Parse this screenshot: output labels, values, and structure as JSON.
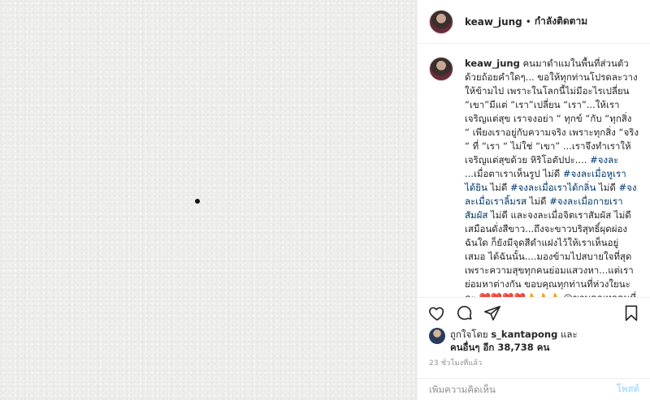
{
  "post": {
    "username": "keaw_jung",
    "separator": "•",
    "follow_status": "กำลังติดตาม"
  },
  "caption": {
    "username": "keaw_jung",
    "text_1": " คนมาดำแมในพื้นที่ส่วนตัว ด้วยถ้อยคำใดๆ... ขอให้ทุกท่านโปรดละวางให้ข้ามไป เพราะในโลกนี้ไม่มีอะไรเปลี่ยน “เขา”มีแต่ “เรา”เปลี่ยน “เรา”...ให้เราเจริญแต่สุข เราจงอย่า “ ทุกข์ “กับ “ทุกสิ่ง “ เพียงเราอยู่กับความจริง เพราะทุกสิ่ง “จริง “ ที่ “เรา “ ไม่ใช่ “เขา” ...เราจึงทำเราให้เจริญแต่สุขด้วย หิริโอตัปปะ.... ",
    "tag_1": "#จงละ",
    "text_2": " ...เมื่อตาเราเห็นรูป ไม่ดี ",
    "tag_2": "#จงละเมื่อหูเราได้ยิน",
    "text_3": " ไม่ดี ",
    "tag_3": "#จงละเมื่อเราได้กลิ่น",
    "text_4": " ไม่ดี ",
    "tag_4": "#จงละเมื่อเราลิ้มรส",
    "text_5": " ไม่ดี ",
    "tag_5": "#จงละเมื่อกายเราสัมผัส",
    "text_6": " ไม่ดี และจงละเมื่อจิตเราสัมผัส ไม่ดี เสมือนดั่งสีขาว...ถึงจะขาวบริสุทธิ์ผุดผ่องฉันใด ก็ยังมีจุดสีดำแฝงไว้ให้เราเห็นอยู่เสมอ ได้ฉันนั้น....มองข้ามไปสบายใจที่สุด เพราะความสุขทุกคนย่อมแสวงหา...แต่เราย่อมหาต่างกัน ขอบคุณทุกท่านที่ห่วงใยนะคะ ❤️❤️❤️❤️👌👌👌 @ขอบคุณทุกคนที่ห่วงใย"
  },
  "icons": {
    "like": "heart-icon",
    "comment": "comment-icon",
    "share": "share-icon",
    "save": "bookmark-icon"
  },
  "likes": {
    "prefix": "ถูกใจโดย ",
    "user": "s_kantapong",
    "middle": " และ",
    "others": "คนอื่นๆ อีก 38,738 คน"
  },
  "timestamp": "23 ชั่วโมงที่แล้ว",
  "comment": {
    "placeholder": "เพิ่มความคิดเห็น",
    "post_label": "โพสต์"
  }
}
